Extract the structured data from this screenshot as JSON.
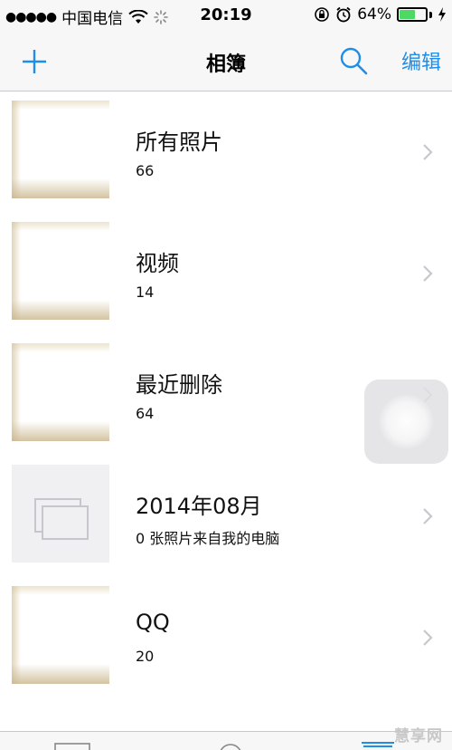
{
  "status_bar": {
    "signal": "●●●●●",
    "carrier": "中国电信",
    "time": "20:19",
    "battery_percent": "64%",
    "battery_level": 0.64,
    "battery_color": "#4cd964"
  },
  "nav": {
    "title": "相簿",
    "edit_label": "编辑",
    "accent_color": "#1f8ee8",
    "add_icon": "plus-icon",
    "search_icon": "search-icon"
  },
  "albums": [
    {
      "title": "所有照片",
      "count": "66"
    },
    {
      "title": "视频",
      "count": "14"
    },
    {
      "title": "最近删除",
      "count": "64"
    },
    {
      "title": "2014年08月",
      "count": "0 张照片来自我的电脑"
    },
    {
      "title": "QQ",
      "count": "20"
    }
  ],
  "watermark": "慧享网"
}
